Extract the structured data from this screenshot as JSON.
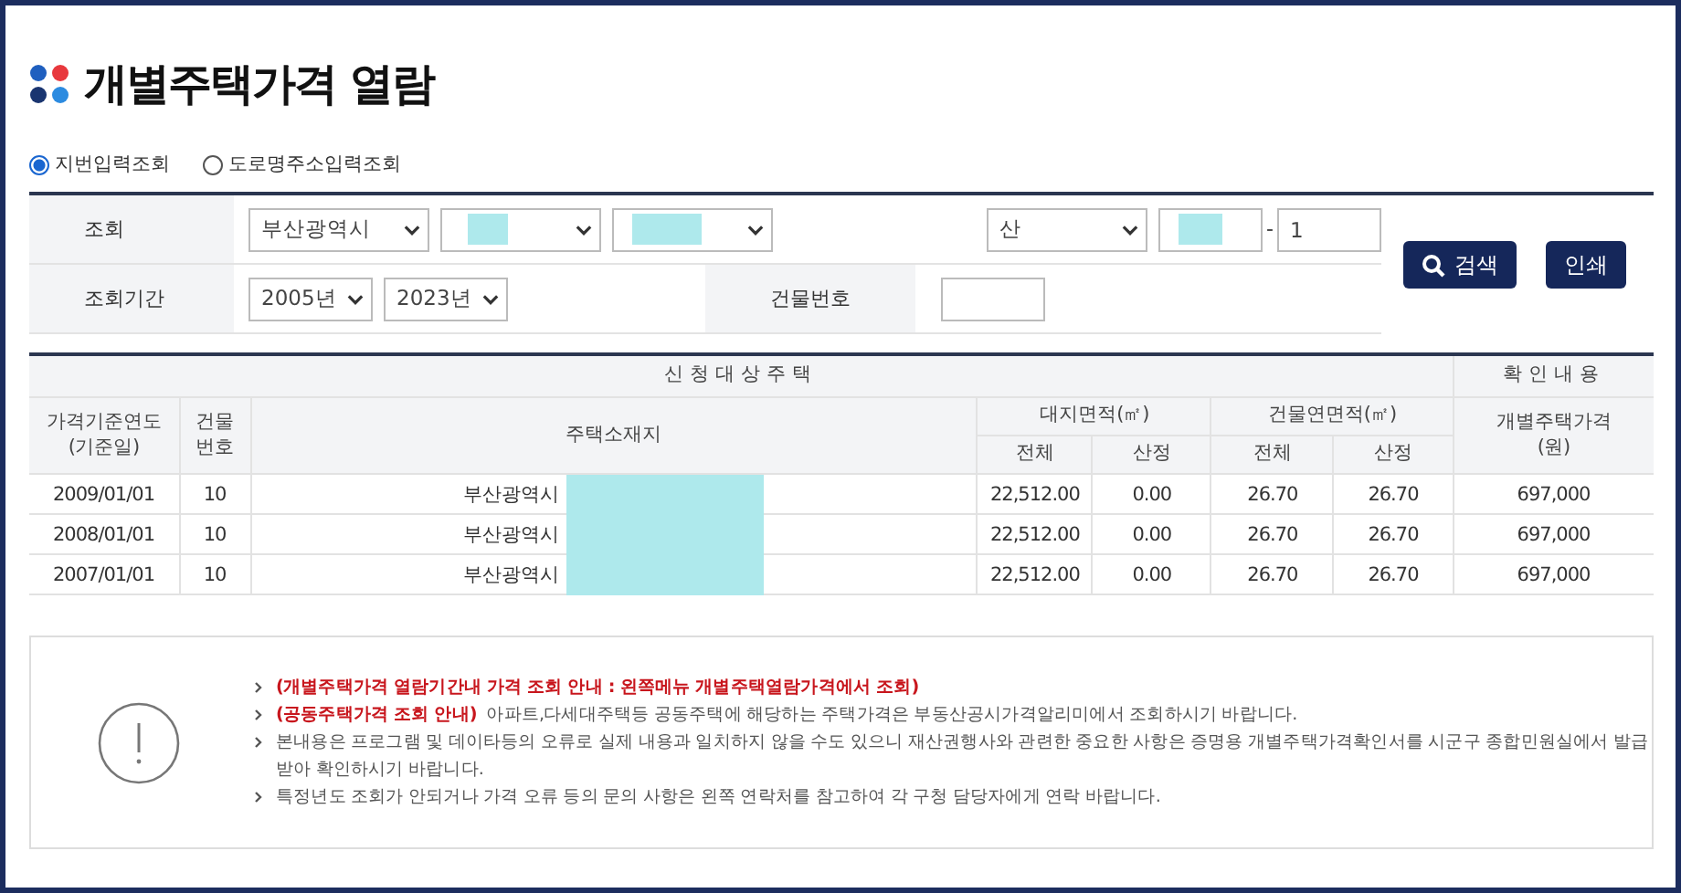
{
  "page": {
    "title": "개별주택가격 열람"
  },
  "search_modes": [
    {
      "label": "지번입력조회",
      "selected": true
    },
    {
      "label": "도로명주소입력조회",
      "selected": false
    }
  ],
  "form": {
    "query_label": "조회",
    "province": {
      "value": "부산광역시"
    },
    "district": {
      "redacted": true
    },
    "town": {
      "redacted": true
    },
    "lot_type": {
      "value": "산"
    },
    "main_number": {
      "redacted": true
    },
    "separator": "-",
    "sub_number": {
      "value": "1"
    },
    "period_label": "조회기간",
    "year_from": "2005년",
    "year_to": "2023년",
    "building_label": "건물번호"
  },
  "buttons": [
    {
      "kind": "search",
      "label": "검색"
    },
    {
      "kind": "print",
      "label": "인쇄"
    }
  ],
  "table": {
    "group_target": "신청대상주택",
    "group_confirm": "확인내용",
    "base_date": "가격기준연도\n(기준일)",
    "building_no": "건물\n번호",
    "address": "주택소재지",
    "land_area": "대지면적(㎡)",
    "floor_area": "건물연면적(㎡)",
    "price": "개별주택가격\n(원)",
    "land_total": "전체",
    "land_calc": "산정",
    "floor_total": "전체",
    "floor_calc": "산정",
    "rows": [
      {
        "base_date": "2009/01/01",
        "building_no": "10",
        "address": "부산광역시",
        "address_redacted": true,
        "land_total": "22,512.00",
        "land_calc": "0.00",
        "floor_total": "26.70",
        "floor_calc": "26.70",
        "price": "697,000"
      },
      {
        "base_date": "2008/01/01",
        "building_no": "10",
        "address": "부산광역시",
        "address_redacted": true,
        "land_total": "22,512.00",
        "land_calc": "0.00",
        "floor_total": "26.70",
        "floor_calc": "26.70",
        "price": "697,000"
      },
      {
        "base_date": "2007/01/01",
        "building_no": "10",
        "address": "부산광역시",
        "address_redacted": true,
        "land_total": "22,512.00",
        "land_calc": "0.00",
        "floor_total": "26.70",
        "floor_calc": "26.70",
        "price": "697,000"
      }
    ]
  },
  "notices": [
    {
      "highlight": "(개별주택가격 열람기간내 가격 조회 안내 : 왼쪽메뉴 개별주택열람가격에서 조회)"
    },
    {
      "highlight": "(공동주택가격 조회 안내)",
      "text": "아파트,다세대주택등 공동주택에 해당하는 주택가격은 부동산공시가격알리미에서 조회하시기 바랍니다."
    },
    {
      "text": "본내용은 프로그램 및 데이타등의 오류로 실제 내용과 일치하지 않을 수도 있으니 재산권행사와 관련한 중요한 사항은 증명용 개별주택가격확인서를 시군구 종합민원실에서 발급받아 확인하시기 바랍니다."
    },
    {
      "text": "특정년도 조회가 안되거나 가격 오류 등의 문의 사항은 왼쪽 연락처를 참고하여 각 구청 담당자에게 연락 바랍니다."
    }
  ]
}
